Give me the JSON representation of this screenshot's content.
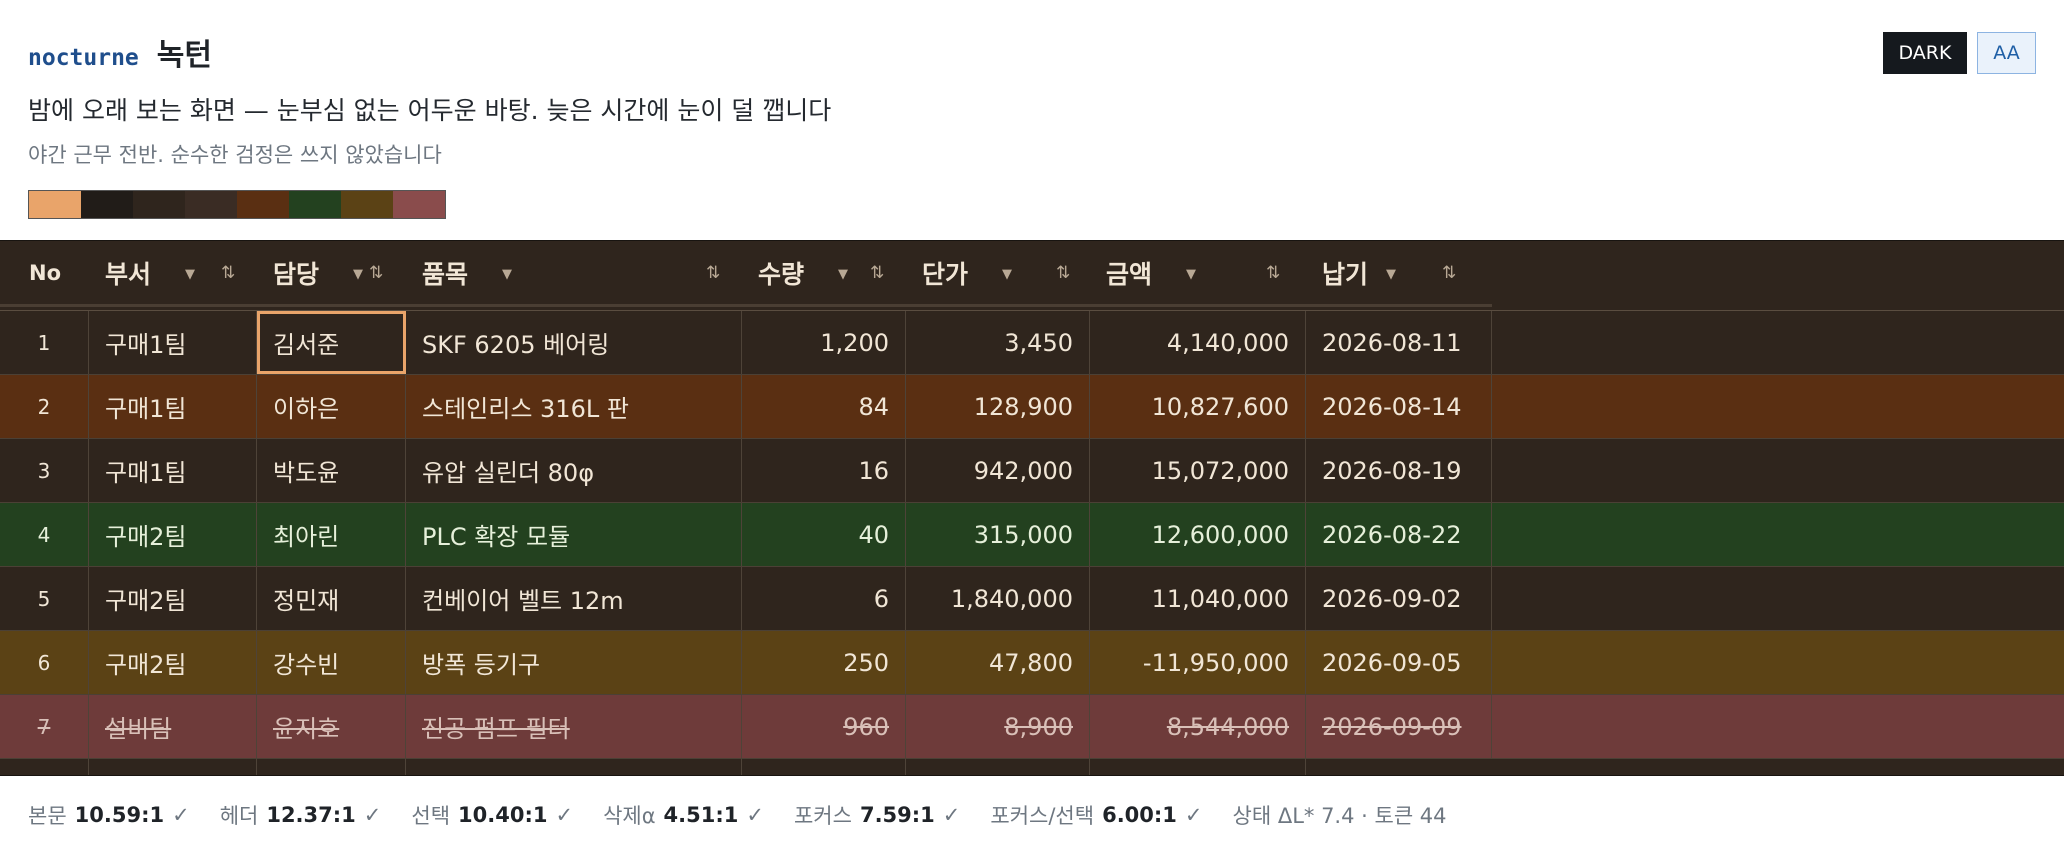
{
  "header": {
    "brand": "nocturne",
    "name_ko": "녹턴",
    "subtitle": "밤에 오래 보는 화면 — 눈부심 없는 어두운 바탕. 늦은 시간에 눈이 덜 깹니다",
    "subnote": "야간 근무 전반. 순수한 검정은 쓰지 않았습니다",
    "swatches": [
      "#e9a46a",
      "#211c18",
      "#2f251d",
      "#3a2c24",
      "#5a2f12",
      "#23411f",
      "#5b4215",
      "#8a4c4c"
    ],
    "dark_button": "DARK",
    "aa_button": "AA"
  },
  "grid": {
    "columns": [
      {
        "key": "no",
        "label": "No"
      },
      {
        "key": "dept",
        "label": "부서"
      },
      {
        "key": "owner",
        "label": "담당"
      },
      {
        "key": "item",
        "label": "품목"
      },
      {
        "key": "qty",
        "label": "수량"
      },
      {
        "key": "price",
        "label": "단가"
      },
      {
        "key": "amount",
        "label": "금액"
      },
      {
        "key": "due",
        "label": "납기"
      }
    ],
    "icons": {
      "dropdown": "triangle-down-icon",
      "sort": "sort-updown-icon"
    },
    "rows": [
      {
        "no": "1",
        "dept": "구매1팀",
        "owner": "김서준",
        "item": "SKF 6205 베어링",
        "qty": "1,200",
        "price": "3,450",
        "amount": "4,140,000",
        "due": "2026-08-11",
        "bg": "#2f251d",
        "state": "focus"
      },
      {
        "no": "2",
        "dept": "구매1팀",
        "owner": "이하은",
        "item": "스테인리스 316L 판",
        "qty": "84",
        "price": "128,900",
        "amount": "10,827,600",
        "due": "2026-08-14",
        "bg": "#5a2f12",
        "state": "selected"
      },
      {
        "no": "3",
        "dept": "구매1팀",
        "owner": "박도윤",
        "item": "유압 실린더 80φ",
        "qty": "16",
        "price": "942,000",
        "amount": "15,072,000",
        "due": "2026-08-19",
        "bg": "#2f251d",
        "state": "normal"
      },
      {
        "no": "4",
        "dept": "구매2팀",
        "owner": "최아린",
        "item": "PLC 확장 모듈",
        "qty": "40",
        "price": "315,000",
        "amount": "12,600,000",
        "due": "2026-08-22",
        "bg": "#23411f",
        "state": "positive"
      },
      {
        "no": "5",
        "dept": "구매2팀",
        "owner": "정민재",
        "item": "컨베이어 벨트 12m",
        "qty": "6",
        "price": "1,840,000",
        "amount": "11,040,000",
        "due": "2026-09-02",
        "bg": "#2f251d",
        "state": "normal"
      },
      {
        "no": "6",
        "dept": "구매2팀",
        "owner": "강수빈",
        "item": "방폭 등기구",
        "qty": "250",
        "price": "47,800",
        "amount": "-11,950,000",
        "due": "2026-09-05",
        "bg": "#5b4215",
        "state": "warning"
      },
      {
        "no": "7",
        "dept": "설비팀",
        "owner": "윤지호",
        "item": "진공 펌프 필터",
        "qty": "960",
        "price": "8,900",
        "amount": "8,544,000",
        "due": "2026-09-09",
        "bg": "#6e3b3a",
        "state": "deleted"
      }
    ]
  },
  "footer": {
    "items": [
      {
        "label": "본문",
        "value": "10.59:1",
        "check": "✓"
      },
      {
        "label": "헤더",
        "value": "12.37:1",
        "check": "✓"
      },
      {
        "label": "선택",
        "value": "10.40:1",
        "check": "✓"
      },
      {
        "label": "삭제α",
        "value": "4.51:1",
        "check": "✓"
      },
      {
        "label": "포커스",
        "value": "7.59:1",
        "check": "✓"
      },
      {
        "label": "포커스/선택",
        "value": "6.00:1",
        "check": "✓"
      }
    ],
    "status": "상태 ΔL* 7.4 · 토큰 44"
  }
}
